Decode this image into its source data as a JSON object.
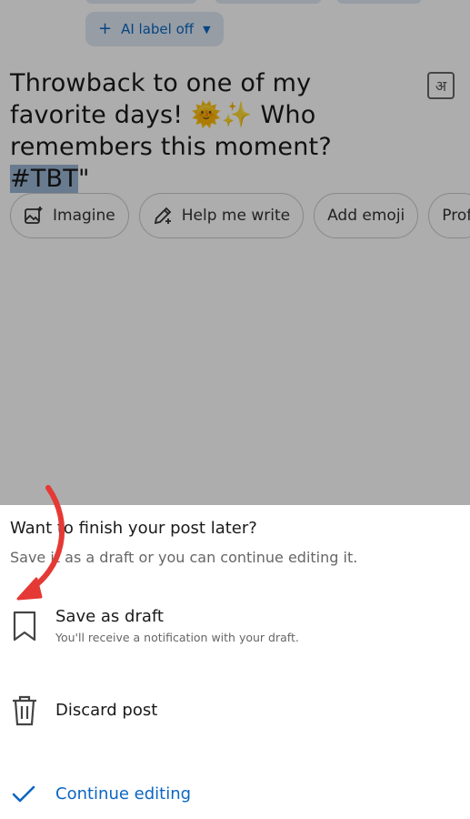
{
  "composer": {
    "ai_label_chip": "AI label off",
    "post_text_main": "Throwback to one of my favorite days! 🌞✨ Who remembers this moment? ",
    "post_text_hashtag": "#TBT",
    "post_text_tail": "\"",
    "transliterate_glyph": "अ",
    "ai_actions": [
      {
        "label": "Imagine",
        "icon": "image-sparkle-icon"
      },
      {
        "label": "Help me write",
        "icon": "pencil-icon"
      },
      {
        "label": "Add emoji"
      },
      {
        "label": "Prof"
      }
    ]
  },
  "sheet": {
    "title": "Want to finish your post later?",
    "subtitle": "Save it as a draft or you can continue editing it.",
    "options": [
      {
        "label": "Save as draft",
        "sub": "You'll receive a notification with your draft.",
        "icon": "bookmark-icon"
      },
      {
        "label": "Discard post",
        "icon": "trash-icon"
      },
      {
        "label": "Continue editing",
        "icon": "checkmark-icon"
      }
    ]
  },
  "colors": {
    "accent": "#0a66c2",
    "annotation_arrow": "#e53935",
    "overlay": "rgba(0,0,0,0.32)"
  }
}
